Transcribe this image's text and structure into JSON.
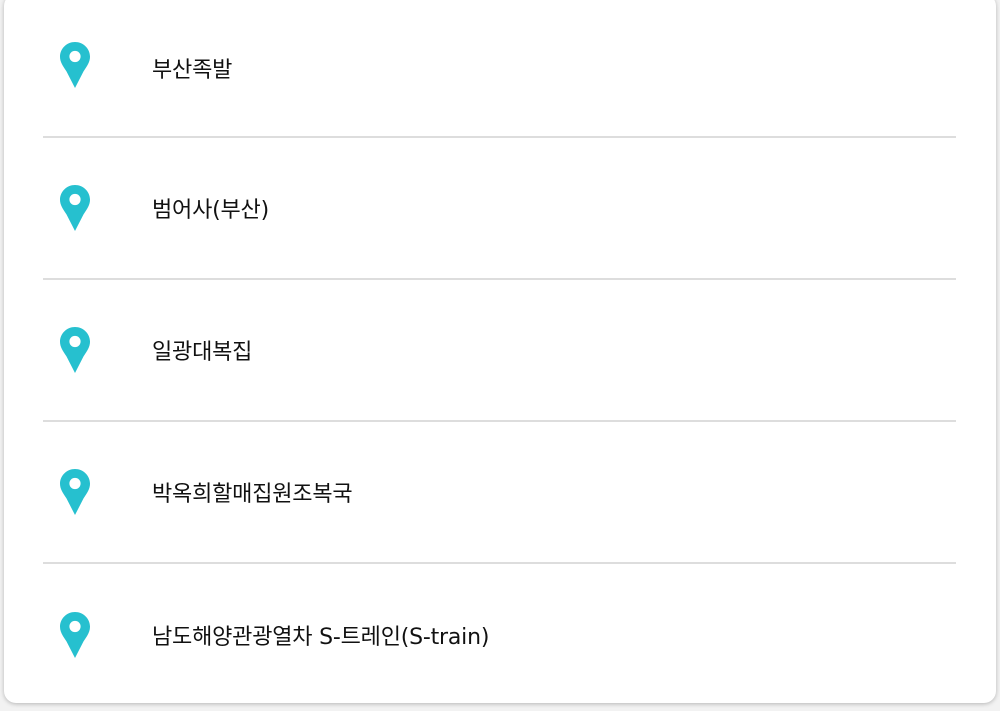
{
  "colors": {
    "pin": "#26c0cf",
    "divider": "#dddddd",
    "text": "#111111"
  },
  "places": [
    {
      "name": "부산족발",
      "icon": "map-pin-icon"
    },
    {
      "name": "범어사(부산)",
      "icon": "map-pin-icon"
    },
    {
      "name": "일광대복집",
      "icon": "map-pin-icon"
    },
    {
      "name": "박옥희할매집원조복국",
      "icon": "map-pin-icon"
    },
    {
      "name": "남도해양관광열차 S-트레인(S-train)",
      "icon": "map-pin-icon"
    }
  ]
}
